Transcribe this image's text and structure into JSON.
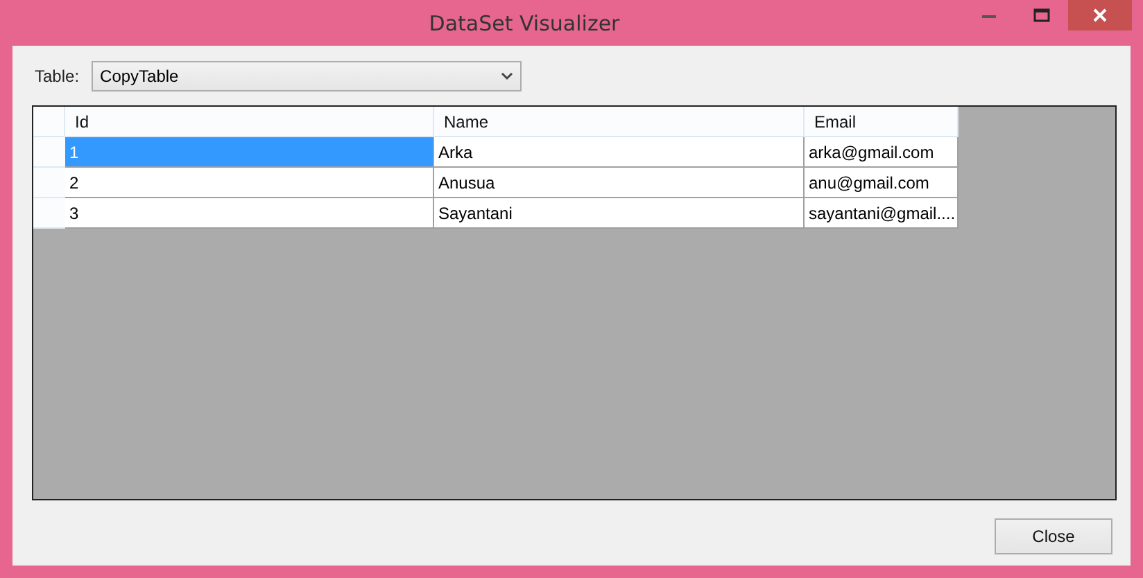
{
  "window": {
    "title": "DataSet Visualizer"
  },
  "table_picker": {
    "label": "Table:",
    "value": "CopyTable"
  },
  "grid": {
    "columns": [
      "Id",
      "Name",
      "Email"
    ],
    "rows": [
      {
        "cells": [
          {
            "text": "1",
            "selected": true
          },
          {
            "text": "Arka",
            "selected": false
          },
          {
            "text": "arka@gmail.com",
            "selected": false
          }
        ]
      },
      {
        "cells": [
          {
            "text": "2",
            "selected": false
          },
          {
            "text": "Anusua",
            "selected": false
          },
          {
            "text": "anu@gmail.com",
            "selected": false
          }
        ]
      },
      {
        "cells": [
          {
            "text": "3",
            "selected": false
          },
          {
            "text": "Sayantani",
            "selected": false
          },
          {
            "text": "sayantani@gmail....",
            "selected": false
          }
        ]
      }
    ]
  },
  "buttons": [
    "Close"
  ]
}
